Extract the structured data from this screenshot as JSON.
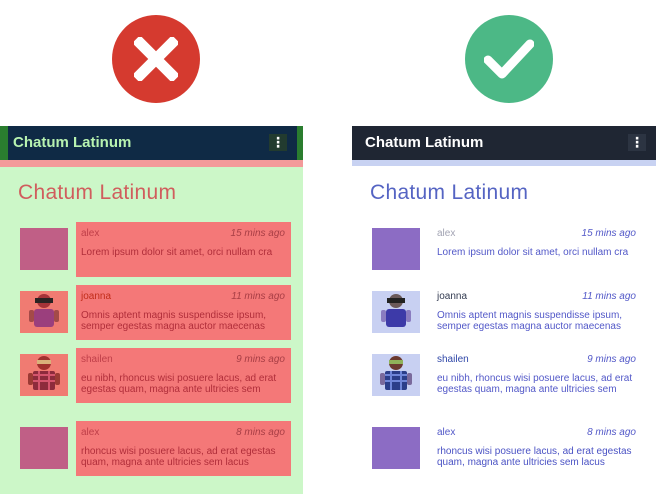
{
  "colors": {
    "bad_badge": "#d53a2f",
    "good_badge": "#4cb886",
    "left_bg": "#ccf7c8",
    "bubble_bad": "#f47878",
    "title_good": "#5564c3"
  },
  "icons": {
    "bad": "x-mark-icon",
    "good": "check-mark-icon",
    "menu": "more-vert-icon"
  },
  "panels": {
    "bad": {
      "appbar_title": "Chatum Latinum",
      "menu_glyph": "⋮",
      "page_title": "Chatum Latinum",
      "messages": [
        {
          "author": "alex",
          "time": "15 mins ago",
          "text": "Lorem ipsum dolor sit amet, orci nullam cra"
        },
        {
          "author": "joanna",
          "time": "11 mins ago",
          "text": "Omnis aptent magnis suspendisse ipsum, semper egestas magna auctor maecenas"
        },
        {
          "author": "shailen",
          "time": "9 mins ago",
          "text": "eu nibh, rhoncus wisi posuere lacus, ad erat egestas quam, magna ante ultricies sem"
        },
        {
          "author": "alex",
          "time": "8 mins ago",
          "text": "rhoncus wisi posuere lacus, ad erat egestas quam, magna ante ultricies sem lacus"
        }
      ]
    },
    "good": {
      "appbar_title": "Chatum Latinum",
      "menu_glyph": "⋮",
      "page_title": "Chatum Latinum",
      "messages": [
        {
          "author": "alex",
          "time": "15 mins ago",
          "text": "Lorem ipsum dolor sit amet, orci nullam cra"
        },
        {
          "author": "joanna",
          "time": "11 mins ago",
          "text": "Omnis aptent magnis suspendisse ipsum, semper egestas magna auctor maecenas"
        },
        {
          "author": "shailen",
          "time": "9 mins ago",
          "text": "eu nibh, rhoncus wisi posuere lacus, ad erat egestas quam, magna ante ultricies sem"
        },
        {
          "author": "alex",
          "time": "8 mins ago",
          "text": "rhoncus wisi posuere lacus, ad erat egestas quam, magna ante ultricies sem lacus"
        }
      ]
    }
  }
}
